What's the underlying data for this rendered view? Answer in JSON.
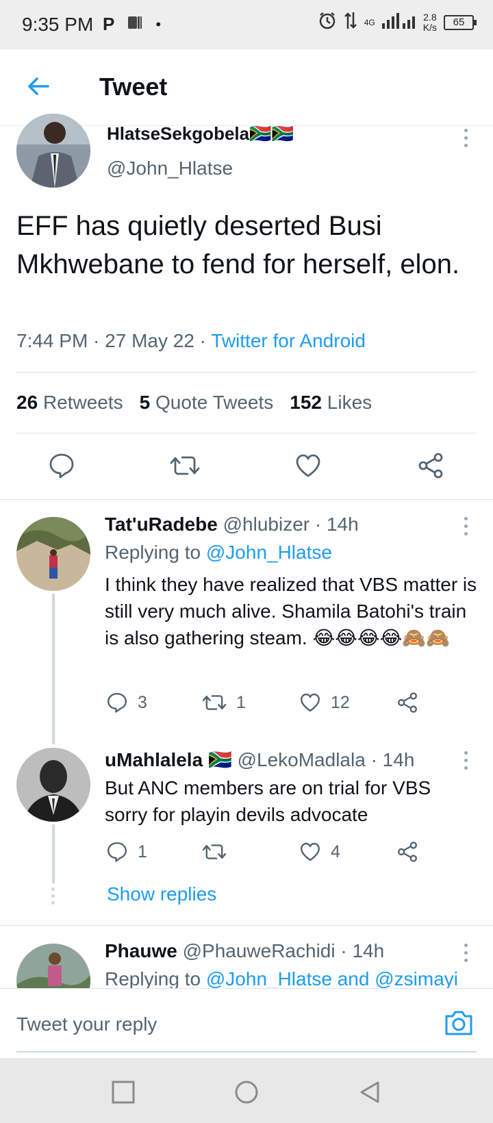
{
  "status_bar": {
    "time": "9:35 PM",
    "network": "4G",
    "speed_value": "2.8",
    "speed_unit": "K/s",
    "battery": "65"
  },
  "header": {
    "title": "Tweet"
  },
  "main_tweet": {
    "author": "HlatseSekgobela🇿🇦🇿🇦",
    "handle": "@John_Hlatse",
    "text": "EFF has quietly deserted Busi Mkhwebane to fend for herself, elon.",
    "time_date": "7:44 PM · 27 May 22 · ",
    "source": "Twitter for Android",
    "retweets_count": "26",
    "retweets_label": "Retweets",
    "quotes_count": "5",
    "quotes_label": "Quote Tweets",
    "likes_count": "152",
    "likes_label": "Likes"
  },
  "replies": [
    {
      "name": "Tat'uRadebe",
      "handle_time": "@hlubizer · 14h",
      "replying_label": "Replying to ",
      "replying_to": "@John_Hlatse",
      "text": "I think they have realized that VBS matter is still very much alive. Shamila Batohi's train is also gathering steam. 😂😂😂😂🙈🙈",
      "reply_count": "3",
      "retweet_count": "1",
      "like_count": "12"
    },
    {
      "name": "uMahlalela 🇿🇦",
      "handle_time": "@LekoMadlala · 14h",
      "text": "But ANC members are on trial for VBS sorry for playin devils advocate",
      "reply_count": "1",
      "retweet_count": "",
      "like_count": "4",
      "show_replies": "Show replies"
    },
    {
      "name": "Phauwe",
      "handle_time": "@PhauweRachidi · 14h",
      "replying_label": "Replying to ",
      "replying_to": "@John_Hlatse and @zsimayi"
    }
  ],
  "reply_bar": {
    "placeholder": "Tweet your reply"
  },
  "colors": {
    "accent": "#1d9bf0",
    "secondary_text": "#536471"
  }
}
